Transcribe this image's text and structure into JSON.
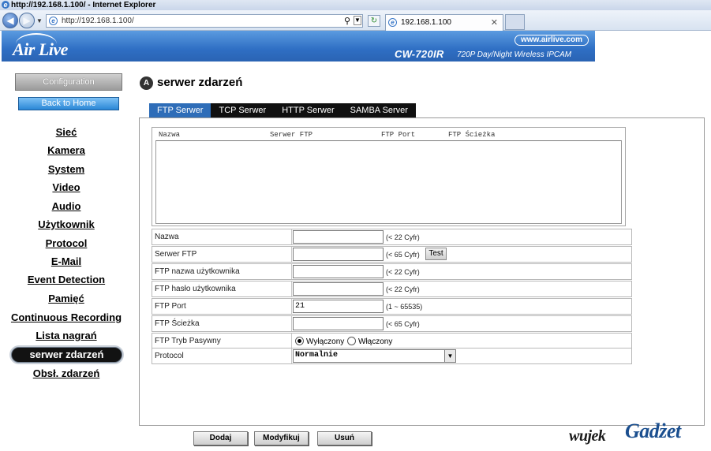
{
  "browser": {
    "title": "http://192.168.1.100/ - Internet Explorer",
    "address": "http://192.168.1.100/",
    "tab_label": "192.168.1.100",
    "tab_close": "✕"
  },
  "header": {
    "logo": "Air Live",
    "url": "www.airlive.com",
    "model": "CW-720IR",
    "description": "720P Day/Night Wireless IPCAM"
  },
  "sidebar": {
    "configuration": "Configuration",
    "back_home": "Back to Home",
    "items": [
      {
        "label": "Sieć"
      },
      {
        "label": "Kamera"
      },
      {
        "label": "System"
      },
      {
        "label": "Video"
      },
      {
        "label": "Audio"
      },
      {
        "label": "Użytkownik"
      },
      {
        "label": "Protocol"
      },
      {
        "label": "E-Mail"
      },
      {
        "label": "Event Detection"
      },
      {
        "label": "Pamięć"
      },
      {
        "label": "Continuous Recording"
      },
      {
        "label": "Lista nagrań"
      },
      {
        "label": "serwer zdarzeń"
      },
      {
        "label": "Obsł. zdarzeń"
      }
    ]
  },
  "main": {
    "title": "serwer zdarzeń",
    "tabs": [
      {
        "label": "FTP Serwer"
      },
      {
        "label": "TCP Serwer"
      },
      {
        "label": "HTTP Serwer"
      },
      {
        "label": "SAMBA Server"
      }
    ],
    "list_headers": [
      "Nazwa",
      "Serwer FTP",
      "FTP Port",
      "FTP Ścieżka"
    ],
    "form": {
      "name_label": "Nazwa",
      "name_value": "",
      "name_hint": "(< 22 Cyfr)",
      "server_label": "Serwer FTP",
      "server_value": "",
      "server_hint": "(< 65 Cyfr)",
      "test_label": "Test",
      "user_label": "FTP nazwa użytkownika",
      "user_value": "",
      "user_hint": "(< 22 Cyfr)",
      "pass_label": "FTP hasło użytkownika",
      "pass_value": "",
      "pass_hint": "(< 22 Cyfr)",
      "port_label": "FTP Port",
      "port_value": "21",
      "port_hint": "(1 ~ 65535)",
      "path_label": "FTP Ścieżka",
      "path_value": "",
      "path_hint": "(< 65 Cyfr)",
      "passive_label": "FTP Tryb Pasywny",
      "passive_off": "Wyłączony",
      "passive_on": "Włączony",
      "protocol_label": "Protocol",
      "protocol_value": "Normalnie"
    },
    "buttons": {
      "add": "Dodaj",
      "modify": "Modyfikuj",
      "delete": "Usuń"
    }
  },
  "watermark": {
    "left": "wujek",
    "right": "Gadżet"
  }
}
